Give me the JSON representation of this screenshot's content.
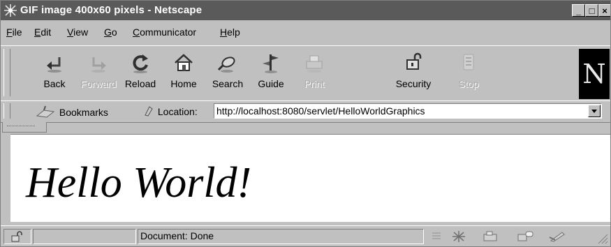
{
  "window": {
    "title": "GIF image 400x60 pixels - Netscape",
    "controls": {
      "minimize": "_",
      "maximize": "□",
      "close": "×"
    }
  },
  "menu": [
    {
      "prefix": "",
      "accel": "F",
      "rest": "ile"
    },
    {
      "prefix": "",
      "accel": "E",
      "rest": "dit"
    },
    {
      "prefix": "",
      "accel": "V",
      "rest": "iew"
    },
    {
      "prefix": "",
      "accel": "G",
      "rest": "o"
    },
    {
      "prefix": "",
      "accel": "C",
      "rest": "ommunicator"
    },
    {
      "prefix": "",
      "accel": "H",
      "rest": "elp"
    }
  ],
  "toolbar": {
    "buttons": [
      {
        "label": "Back",
        "icon": "back-arrow-icon",
        "enabled": true
      },
      {
        "label": "Forward",
        "icon": "forward-arrow-icon",
        "enabled": false
      },
      {
        "label": "Reload",
        "icon": "reload-icon",
        "enabled": true
      },
      {
        "label": "Home",
        "icon": "home-icon",
        "enabled": true
      },
      {
        "label": "Search",
        "icon": "search-icon",
        "enabled": true
      },
      {
        "label": "Guide",
        "icon": "guide-icon",
        "enabled": true
      },
      {
        "label": "Print",
        "icon": "print-icon",
        "enabled": false
      },
      {
        "label": "Security",
        "icon": "padlock-icon",
        "enabled": true
      },
      {
        "label": "Stop",
        "icon": "stop-icon",
        "enabled": false
      }
    ],
    "logo": "N"
  },
  "location": {
    "bookmarks_label": "Bookmarks",
    "location_label": "Location:",
    "url": "http://localhost:8080/servlet/HelloWorldGraphics"
  },
  "content": {
    "image_text": "Hello World!"
  },
  "status": {
    "text": "Document: Done"
  },
  "colors": {
    "chrome": "#c0c0c0",
    "titlebar": "#5a5a5a",
    "content_bg": "#ffffff"
  }
}
